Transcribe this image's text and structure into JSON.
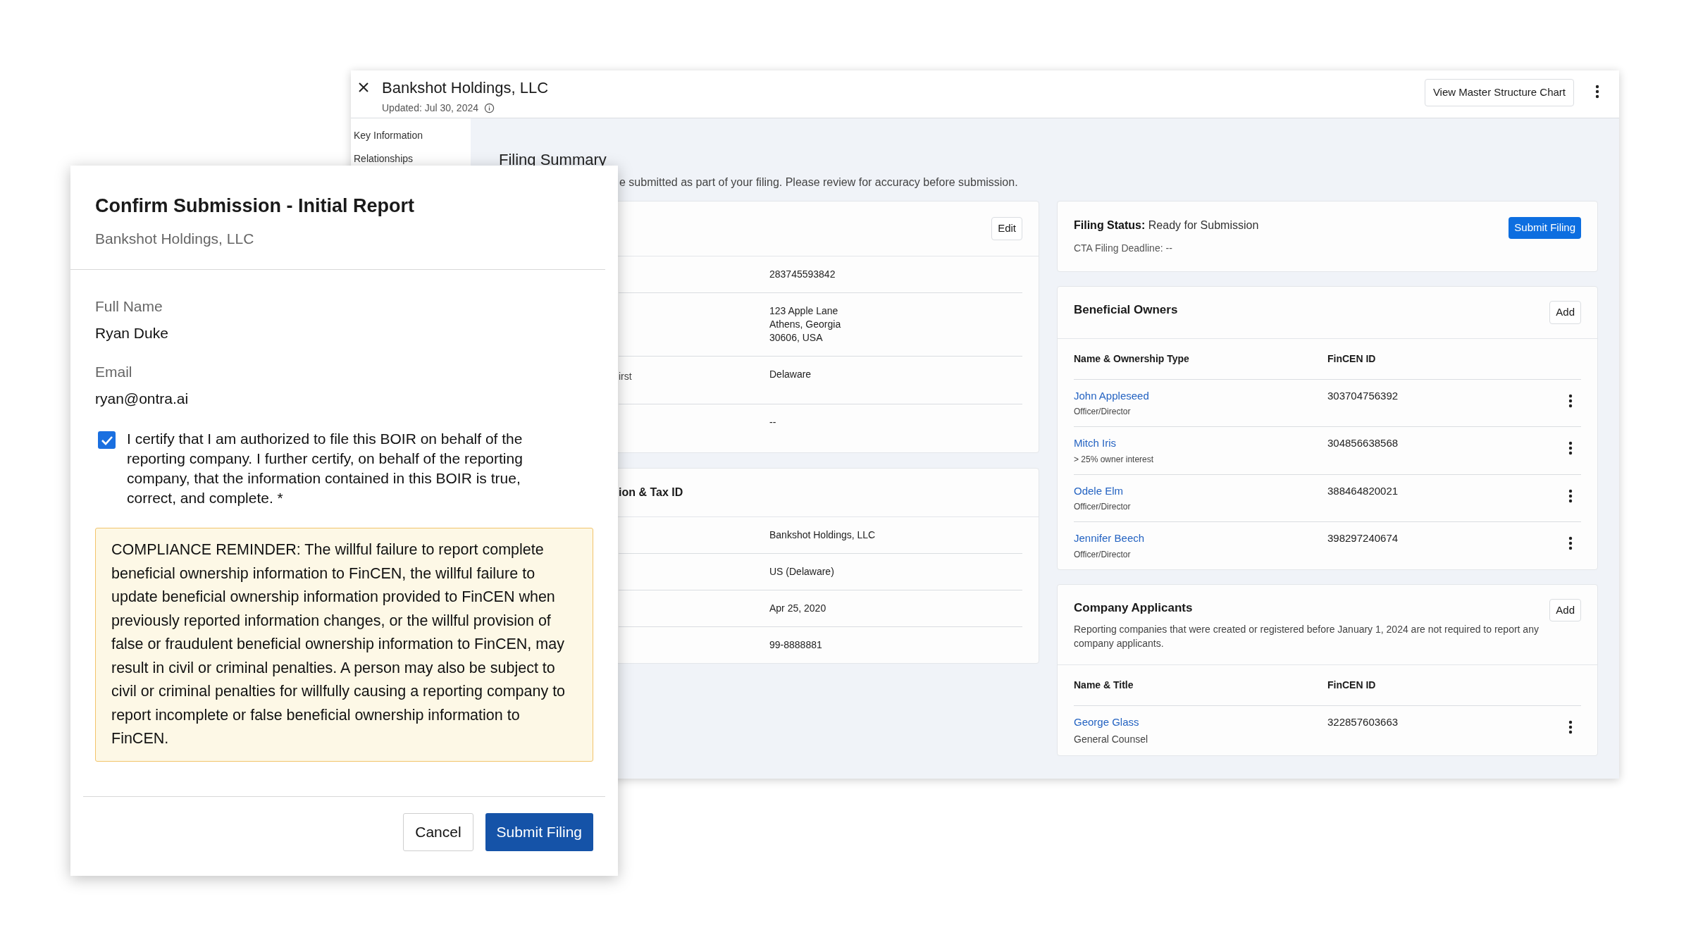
{
  "main_window": {
    "title": "Bankshot Holdings, LLC",
    "updated": "Updated: Jul 30, 2024",
    "header_button": "View Master Structure Chart",
    "sidebar": [
      {
        "label": "Key Information"
      },
      {
        "label": "Relationships"
      }
    ],
    "filing_summary": {
      "title": "Filing Summary",
      "description": "e submitted as part of your filing. Please review for accuracy before submission."
    },
    "details_card": {
      "edit_button": "Edit",
      "rows": [
        {
          "value": "283745593842"
        },
        {
          "value": "123 Apple Lane\nAthens, Georgia\n30606, USA"
        },
        {
          "label": "irst",
          "value": "Delaware"
        },
        {
          "value": "--"
        }
      ]
    },
    "jurisdiction_card": {
      "title": "ion & Tax ID",
      "rows": [
        {
          "value": "Bankshot Holdings, LLC"
        },
        {
          "value": "US (Delaware)"
        },
        {
          "value": "Apr 25, 2020"
        },
        {
          "value": "99-8888881"
        }
      ]
    },
    "status_card": {
      "label": "Filing Status:",
      "status": "Ready for Submission",
      "deadline": "CTA Filing Deadline: --",
      "button": "Submit Filing"
    },
    "beneficial_owners": {
      "title": "Beneficial Owners",
      "add_button": "Add",
      "columns": [
        "Name & Ownership Type",
        "FinCEN ID"
      ],
      "rows": [
        {
          "name": "John Appleseed",
          "type": "Officer/Director",
          "fincen_id": "303704756392"
        },
        {
          "name": "Mitch Iris",
          "type": "> 25% owner interest",
          "fincen_id": "304856638568"
        },
        {
          "name": "Odele Elm",
          "type": "Officer/Director",
          "fincen_id": "388464820021"
        },
        {
          "name": "Jennifer Beech",
          "type": "Officer/Director",
          "fincen_id": "398297240674"
        }
      ]
    },
    "company_applicants": {
      "title": "Company Applicants",
      "note": "Reporting companies that were created or registered before January 1, 2024 are not required to report any company applicants.",
      "add_button": "Add",
      "columns": [
        "Name & Title",
        "FinCEN ID"
      ],
      "rows": [
        {
          "name": "George Glass",
          "type": "General Counsel",
          "fincen_id": "322857603663"
        }
      ]
    }
  },
  "dialog": {
    "title": "Confirm Submission - Initial Report",
    "subtitle": "Bankshot Holdings, LLC",
    "fields": [
      {
        "label": "Full Name",
        "value": "Ryan Duke"
      },
      {
        "label": "Email",
        "value": "ryan@ontra.ai"
      }
    ],
    "certification": {
      "checked": true,
      "text": "I certify that I am authorized to file this BOIR on behalf of the reporting company. I further certify, on behalf of the reporting company, that the information contained in this BOIR is true, correct, and complete. *"
    },
    "reminder": "COMPLIANCE REMINDER: The willful failure to report complete beneficial ownership information to FinCEN, the willful failure to update beneficial ownership information provided to FinCEN when previously reported information changes, or the willful provision of false or fraudulent beneficial ownership information to FinCEN, may result in civil or criminal penalties. A person may also be subject to civil or criminal penalties for willfully causing a reporting company to report incomplete or false beneficial ownership information to FinCEN.",
    "buttons": [
      {
        "label": "Cancel",
        "kind": "secondary"
      },
      {
        "label": "Submit Filing",
        "kind": "primary"
      }
    ]
  }
}
